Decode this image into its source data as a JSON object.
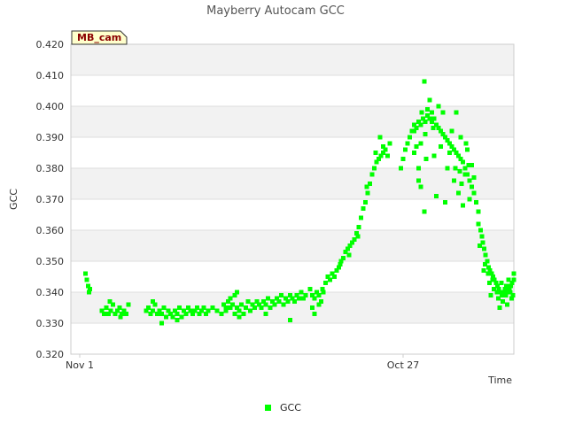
{
  "chart_data": {
    "type": "scatter",
    "title": "Mayberry Autocam GCC",
    "xlabel": "Time",
    "ylabel": "GCC",
    "badge": "MB_cam",
    "x_ticks": [
      "Nov 1",
      "Oct 27"
    ],
    "xlim": [
      0,
      100
    ],
    "ylim": [
      0.32,
      0.42
    ],
    "y_ticks": [
      "0.320",
      "0.330",
      "0.340",
      "0.350",
      "0.360",
      "0.370",
      "0.380",
      "0.390",
      "0.400",
      "0.410",
      "0.420"
    ],
    "grid": true,
    "legend_position": "bottom-center",
    "series": [
      {
        "name": "GCC",
        "color": "#00ff00",
        "points": [
          [
            3.3,
            0.346
          ],
          [
            3.6,
            0.344
          ],
          [
            3.9,
            0.342
          ],
          [
            4.1,
            0.34
          ],
          [
            4.3,
            0.341
          ],
          [
            7.0,
            0.334
          ],
          [
            7.5,
            0.333
          ],
          [
            8.0,
            0.335
          ],
          [
            8.5,
            0.333
          ],
          [
            9.0,
            0.334
          ],
          [
            9.5,
            0.336
          ],
          [
            10.0,
            0.333
          ],
          [
            10.5,
            0.334
          ],
          [
            11.0,
            0.335
          ],
          [
            11.5,
            0.333
          ],
          [
            12.0,
            0.334
          ],
          [
            12.5,
            0.333
          ],
          [
            13.0,
            0.336
          ],
          [
            11.2,
            0.332
          ],
          [
            8.8,
            0.337
          ],
          [
            17.0,
            0.334
          ],
          [
            17.5,
            0.335
          ],
          [
            18.0,
            0.333
          ],
          [
            18.5,
            0.334
          ],
          [
            19.0,
            0.336
          ],
          [
            19.5,
            0.333
          ],
          [
            20.0,
            0.334
          ],
          [
            20.5,
            0.333
          ],
          [
            21.0,
            0.335
          ],
          [
            21.5,
            0.332
          ],
          [
            22.0,
            0.334
          ],
          [
            22.5,
            0.333
          ],
          [
            23.0,
            0.332
          ],
          [
            23.5,
            0.334
          ],
          [
            24.0,
            0.333
          ],
          [
            24.5,
            0.335
          ],
          [
            25.0,
            0.332
          ],
          [
            25.5,
            0.334
          ],
          [
            26.0,
            0.333
          ],
          [
            26.5,
            0.335
          ],
          [
            27.0,
            0.334
          ],
          [
            27.5,
            0.333
          ],
          [
            28.0,
            0.334
          ],
          [
            28.5,
            0.335
          ],
          [
            29.0,
            0.333
          ],
          [
            29.5,
            0.334
          ],
          [
            30.0,
            0.335
          ],
          [
            30.5,
            0.333
          ],
          [
            31.0,
            0.334
          ],
          [
            32.0,
            0.335
          ],
          [
            33.0,
            0.334
          ],
          [
            34.0,
            0.333
          ],
          [
            35.0,
            0.334
          ],
          [
            36.0,
            0.335
          ],
          [
            37.0,
            0.333
          ],
          [
            20.5,
            0.33
          ],
          [
            24.0,
            0.331
          ],
          [
            18.5,
            0.337
          ],
          [
            34.5,
            0.336
          ],
          [
            35.0,
            0.335
          ],
          [
            35.5,
            0.337
          ],
          [
            36.0,
            0.338
          ],
          [
            36.5,
            0.336
          ],
          [
            37.0,
            0.339
          ],
          [
            37.5,
            0.335
          ],
          [
            38.0,
            0.334
          ],
          [
            38.5,
            0.336
          ],
          [
            39.0,
            0.333
          ],
          [
            39.5,
            0.335
          ],
          [
            40.0,
            0.337
          ],
          [
            40.5,
            0.334
          ],
          [
            41.0,
            0.336
          ],
          [
            41.5,
            0.335
          ],
          [
            42.0,
            0.337
          ],
          [
            42.5,
            0.336
          ],
          [
            43.0,
            0.335
          ],
          [
            43.5,
            0.337
          ],
          [
            44.0,
            0.336
          ],
          [
            44.5,
            0.338
          ],
          [
            45.0,
            0.335
          ],
          [
            45.5,
            0.337
          ],
          [
            46.0,
            0.336
          ],
          [
            46.5,
            0.338
          ],
          [
            47.0,
            0.337
          ],
          [
            47.5,
            0.339
          ],
          [
            48.0,
            0.336
          ],
          [
            48.5,
            0.338
          ],
          [
            49.0,
            0.337
          ],
          [
            49.5,
            0.339
          ],
          [
            50.0,
            0.338
          ],
          [
            50.5,
            0.337
          ],
          [
            51.0,
            0.339
          ],
          [
            51.5,
            0.338
          ],
          [
            52.0,
            0.34
          ],
          [
            52.5,
            0.338
          ],
          [
            53.0,
            0.339
          ],
          [
            54.5,
            0.335
          ],
          [
            55.0,
            0.333
          ],
          [
            49.5,
            0.331
          ],
          [
            44.0,
            0.333
          ],
          [
            37.5,
            0.34
          ],
          [
            38.0,
            0.332
          ],
          [
            54.0,
            0.341
          ],
          [
            54.5,
            0.339
          ],
          [
            55.0,
            0.338
          ],
          [
            55.5,
            0.34
          ],
          [
            56.0,
            0.339
          ],
          [
            56.5,
            0.337
          ],
          [
            56.8,
            0.341
          ],
          [
            57.0,
            0.34
          ],
          [
            56.0,
            0.336
          ],
          [
            57.5,
            0.343
          ],
          [
            58.0,
            0.345
          ],
          [
            58.5,
            0.344
          ],
          [
            59.0,
            0.346
          ],
          [
            59.5,
            0.345
          ],
          [
            60.0,
            0.347
          ],
          [
            60.5,
            0.348
          ],
          [
            61.0,
            0.35
          ],
          [
            61.5,
            0.351
          ],
          [
            62.0,
            0.353
          ],
          [
            62.5,
            0.354
          ],
          [
            63.0,
            0.355
          ],
          [
            63.5,
            0.356
          ],
          [
            64.0,
            0.357
          ],
          [
            64.5,
            0.359
          ],
          [
            65.0,
            0.361
          ],
          [
            65.5,
            0.364
          ],
          [
            66.0,
            0.367
          ],
          [
            66.5,
            0.369
          ],
          [
            67.0,
            0.372
          ],
          [
            67.5,
            0.375
          ],
          [
            68.0,
            0.378
          ],
          [
            68.5,
            0.38
          ],
          [
            69.0,
            0.382
          ],
          [
            69.5,
            0.383
          ],
          [
            70.0,
            0.384
          ],
          [
            70.5,
            0.385
          ],
          [
            71.0,
            0.386
          ],
          [
            71.5,
            0.384
          ],
          [
            72.0,
            0.388
          ],
          [
            69.8,
            0.39
          ],
          [
            70.5,
            0.387
          ],
          [
            68.8,
            0.385
          ],
          [
            60.8,
            0.349
          ],
          [
            62.8,
            0.352
          ],
          [
            64.8,
            0.358
          ],
          [
            66.8,
            0.374
          ],
          [
            74.5,
            0.38
          ],
          [
            75.0,
            0.383
          ],
          [
            75.5,
            0.386
          ],
          [
            76.0,
            0.388
          ],
          [
            76.5,
            0.39
          ],
          [
            77.0,
            0.392
          ],
          [
            77.5,
            0.394
          ],
          [
            78.0,
            0.393
          ],
          [
            78.5,
            0.395
          ],
          [
            79.0,
            0.394
          ],
          [
            79.5,
            0.396
          ],
          [
            80.0,
            0.395
          ],
          [
            80.5,
            0.397
          ],
          [
            81.0,
            0.396
          ],
          [
            81.5,
            0.395
          ],
          [
            82.0,
            0.396
          ],
          [
            82.5,
            0.394
          ],
          [
            83.0,
            0.393
          ],
          [
            83.5,
            0.392
          ],
          [
            84.0,
            0.391
          ],
          [
            84.5,
            0.39
          ],
          [
            85.0,
            0.389
          ],
          [
            85.5,
            0.388
          ],
          [
            86.0,
            0.387
          ],
          [
            86.5,
            0.386
          ],
          [
            87.0,
            0.385
          ],
          [
            87.5,
            0.384
          ],
          [
            88.0,
            0.383
          ],
          [
            88.5,
            0.382
          ],
          [
            89.0,
            0.38
          ],
          [
            89.5,
            0.378
          ],
          [
            90.0,
            0.376
          ],
          [
            90.5,
            0.374
          ],
          [
            91.0,
            0.372
          ],
          [
            91.5,
            0.369
          ],
          [
            92.0,
            0.366
          ],
          [
            77.5,
            0.385
          ],
          [
            78.5,
            0.38
          ],
          [
            79.0,
            0.388
          ],
          [
            80.0,
            0.391
          ],
          [
            80.5,
            0.399
          ],
          [
            81.0,
            0.402
          ],
          [
            81.5,
            0.398
          ],
          [
            82.0,
            0.384
          ],
          [
            83.0,
            0.4
          ],
          [
            84.0,
            0.398
          ],
          [
            85.0,
            0.38
          ],
          [
            86.0,
            0.392
          ],
          [
            86.5,
            0.376
          ],
          [
            87.0,
            0.398
          ],
          [
            87.5,
            0.372
          ],
          [
            88.0,
            0.39
          ],
          [
            88.5,
            0.368
          ],
          [
            89.0,
            0.378
          ],
          [
            89.5,
            0.386
          ],
          [
            90.0,
            0.37
          ],
          [
            90.5,
            0.381
          ],
          [
            91.0,
            0.377
          ],
          [
            78.5,
            0.376
          ],
          [
            79.0,
            0.374
          ],
          [
            82.5,
            0.371
          ],
          [
            84.5,
            0.369
          ],
          [
            85.5,
            0.385
          ],
          [
            86.8,
            0.38
          ],
          [
            87.8,
            0.379
          ],
          [
            89.2,
            0.388
          ],
          [
            79.8,
            0.408
          ],
          [
            79.8,
            0.366
          ],
          [
            77.5,
            0.392
          ],
          [
            78.0,
            0.387
          ],
          [
            79.2,
            0.398
          ],
          [
            80.2,
            0.383
          ],
          [
            81.8,
            0.393
          ],
          [
            83.5,
            0.387
          ],
          [
            88.2,
            0.375
          ],
          [
            89.8,
            0.381
          ],
          [
            92.0,
            0.362
          ],
          [
            92.5,
            0.36
          ],
          [
            92.8,
            0.358
          ],
          [
            93.0,
            0.356
          ],
          [
            93.3,
            0.354
          ],
          [
            93.6,
            0.352
          ],
          [
            94.0,
            0.35
          ],
          [
            94.3,
            0.348
          ],
          [
            94.6,
            0.347
          ],
          [
            95.0,
            0.346
          ],
          [
            95.3,
            0.345
          ],
          [
            95.6,
            0.344
          ],
          [
            96.0,
            0.343
          ],
          [
            96.3,
            0.342
          ],
          [
            96.6,
            0.341
          ],
          [
            97.0,
            0.34
          ],
          [
            97.3,
            0.339
          ],
          [
            97.6,
            0.34
          ],
          [
            98.0,
            0.341
          ],
          [
            98.3,
            0.342
          ],
          [
            98.6,
            0.34
          ],
          [
            99.0,
            0.341
          ],
          [
            99.3,
            0.342
          ],
          [
            99.6,
            0.343
          ],
          [
            100.0,
            0.344
          ],
          [
            92.3,
            0.355
          ],
          [
            93.5,
            0.349
          ],
          [
            94.5,
            0.343
          ],
          [
            95.5,
            0.341
          ],
          [
            96.5,
            0.338
          ],
          [
            97.5,
            0.337
          ],
          [
            98.5,
            0.336
          ],
          [
            99.5,
            0.338
          ],
          [
            93.2,
            0.347
          ],
          [
            94.2,
            0.346
          ],
          [
            95.2,
            0.344
          ],
          [
            96.2,
            0.34
          ],
          [
            97.2,
            0.343
          ],
          [
            98.2,
            0.339
          ],
          [
            99.2,
            0.34
          ],
          [
            100.0,
            0.346
          ],
          [
            96.8,
            0.335
          ],
          [
            98.8,
            0.344
          ],
          [
            99.8,
            0.339
          ],
          [
            94.8,
            0.339
          ]
        ]
      }
    ]
  }
}
